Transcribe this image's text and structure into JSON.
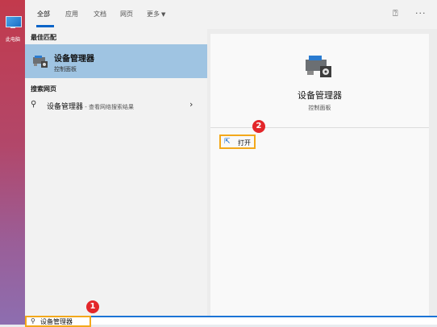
{
  "desktop": {
    "icon_label": "此电脑"
  },
  "tabs": [
    {
      "label": "全部"
    },
    {
      "label": "应用"
    },
    {
      "label": "文档"
    },
    {
      "label": "网页"
    },
    {
      "label": "更多"
    }
  ],
  "best_match": {
    "heading": "最佳匹配",
    "title": "设备管理器",
    "subtitle": "控制面板"
  },
  "web": {
    "heading": "搜索网页",
    "query": "设备管理器",
    "hint": " - 查看网络搜索结果"
  },
  "detail": {
    "title": "设备管理器",
    "subtitle": "控制面板",
    "open_label": "打开"
  },
  "search": {
    "value": "设备管理器"
  },
  "badges": {
    "one": "1",
    "two": "2"
  },
  "colors": {
    "accent": "#0a64c8",
    "highlight": "#f3a81b",
    "badge": "#e3262a",
    "selected": "#9fc4e2"
  }
}
